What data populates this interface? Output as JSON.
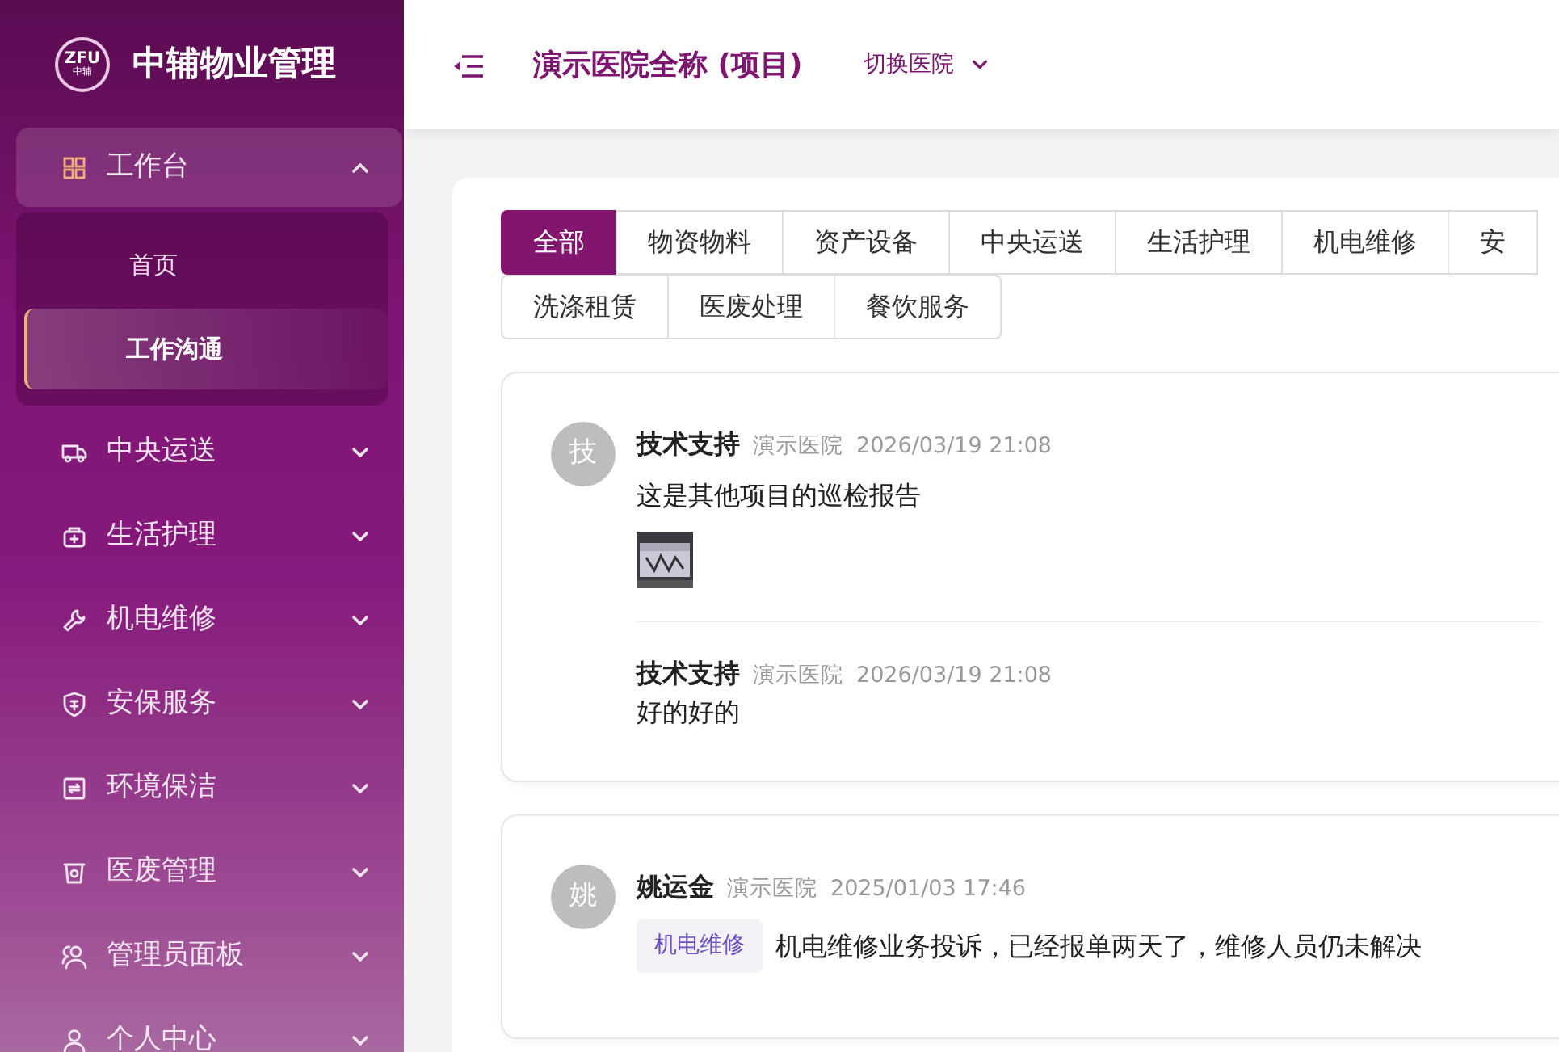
{
  "sidebar": {
    "logo": {
      "mark": "ZFU",
      "sub": "中辅"
    },
    "brand": "中辅物业管理",
    "menu": [
      {
        "label": "工作台",
        "expanded": true,
        "children": [
          {
            "label": "首页",
            "selected": false
          },
          {
            "label": "工作沟通",
            "selected": true
          }
        ]
      },
      {
        "label": "中央运送",
        "expanded": false
      },
      {
        "label": "生活护理",
        "expanded": false
      },
      {
        "label": "机电维修",
        "expanded": false
      },
      {
        "label": "安保服务",
        "expanded": false
      },
      {
        "label": "环境保洁",
        "expanded": false
      },
      {
        "label": "医废管理",
        "expanded": false
      },
      {
        "label": "管理员面板",
        "expanded": false
      },
      {
        "label": "个人中心",
        "expanded": false
      }
    ]
  },
  "header": {
    "title": "演示医院全称 (项目)",
    "switch_label": "切换医院",
    "switch_expanded": false
  },
  "tab_rows": [
    [
      {
        "label": "全部",
        "selected": true
      },
      {
        "label": "物资物料",
        "selected": false
      },
      {
        "label": "资产设备",
        "selected": false
      },
      {
        "label": "中央运送",
        "selected": false
      },
      {
        "label": "生活护理",
        "selected": false
      },
      {
        "label": "机电维修",
        "selected": false
      },
      {
        "label": "安",
        "selected": false
      }
    ],
    [
      {
        "label": "洗涤租赁",
        "selected": false
      },
      {
        "label": "医废处理",
        "selected": false
      },
      {
        "label": "餐饮服务",
        "selected": false
      }
    ]
  ],
  "posts": [
    {
      "avatar": "技",
      "author": "技术支持",
      "org": "演示医院",
      "time": "2026/03/19 21:08",
      "text": "这是其他项目的巡检报告",
      "attachment": {
        "kind": "picture"
      },
      "replies": [
        {
          "author": "技术支持",
          "org": "演示医院",
          "time": "2026/03/19 21:08",
          "text": "好的好的"
        }
      ]
    },
    {
      "avatar": "姚",
      "author": "姚运金",
      "org": "演示医院",
      "time": "2025/01/03 17:46",
      "tag": "机电维修",
      "text": "机电维修业务投诉，已经报单两天了，维修人员仍未解决"
    }
  ]
}
